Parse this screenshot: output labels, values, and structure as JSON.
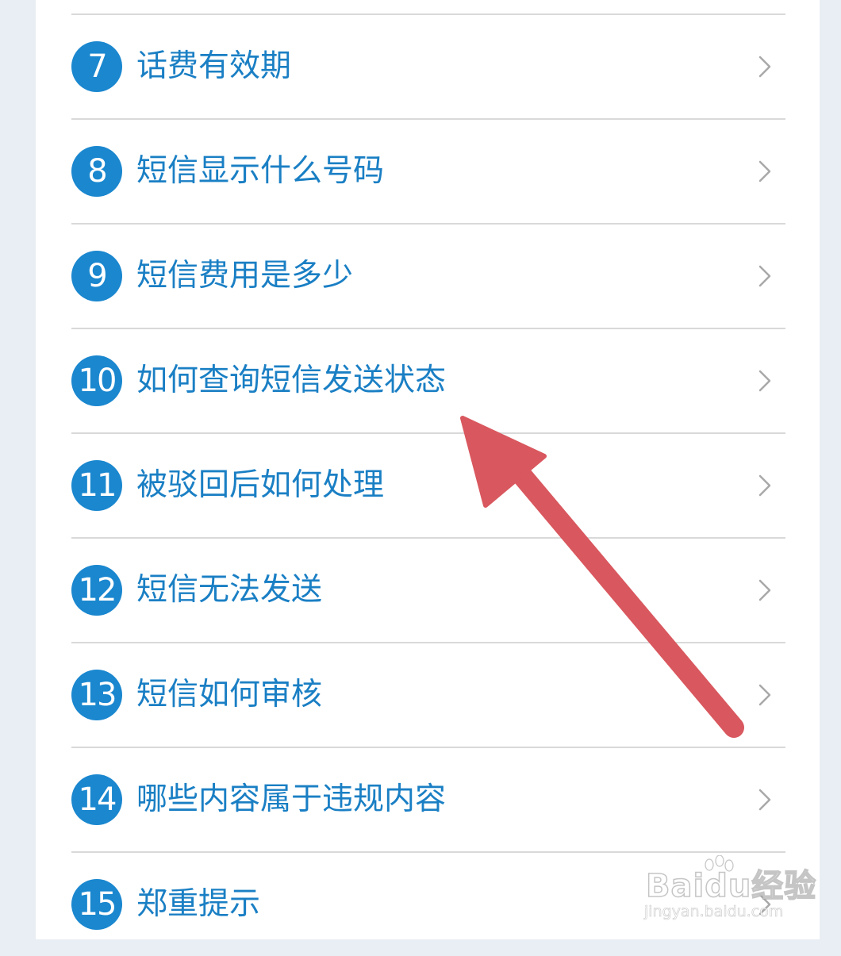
{
  "faq": {
    "items": [
      {
        "number": "7",
        "label": "话费有效期"
      },
      {
        "number": "8",
        "label": "短信显示什么号码"
      },
      {
        "number": "9",
        "label": "短信费用是多少"
      },
      {
        "number": "10",
        "label": "如何查询短信发送状态"
      },
      {
        "number": "11",
        "label": "被驳回后如何处理"
      },
      {
        "number": "12",
        "label": "短信无法发送"
      },
      {
        "number": "13",
        "label": "短信如何审核"
      },
      {
        "number": "14",
        "label": "哪些内容属于违规内容"
      },
      {
        "number": "15",
        "label": "郑重提示"
      }
    ],
    "chevron_icon": "chevron-right-icon"
  },
  "annotation": {
    "arrow_color": "#d9575e",
    "points_to": "如何查询短信发送状态"
  },
  "watermark": {
    "brand": "Baidu经验",
    "url": "jingyan.baidu.com"
  },
  "colors": {
    "badge": "#1a87cf",
    "label": "#1a7fc4",
    "divider": "#d9d9d9",
    "background": "#e9eef4"
  }
}
